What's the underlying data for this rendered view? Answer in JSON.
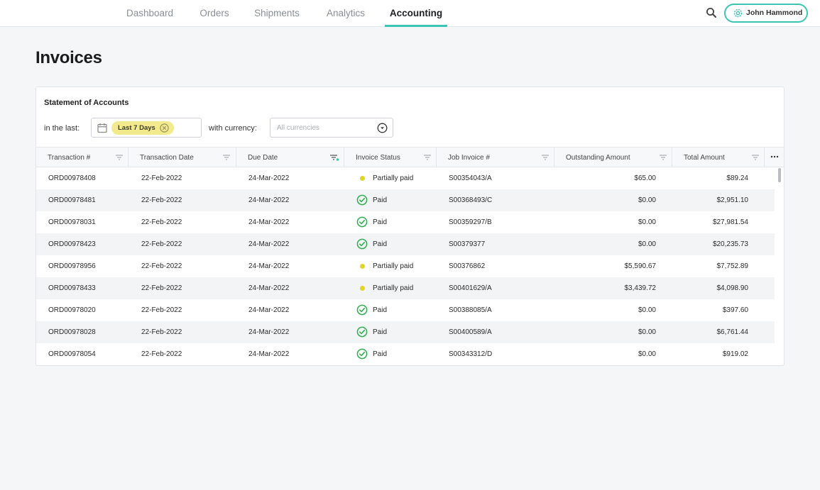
{
  "nav": {
    "tabs": [
      {
        "label": "Dashboard"
      },
      {
        "label": "Orders"
      },
      {
        "label": "Shipments"
      },
      {
        "label": "Analytics"
      },
      {
        "label": "Accounting"
      }
    ],
    "active_tab": "Accounting",
    "search_icon": "search-icon",
    "user": {
      "name": "John Hammond",
      "icon": "gear-icon"
    }
  },
  "page": {
    "title": "Invoices"
  },
  "statement": {
    "title": "Statement of Accounts",
    "period_label": "in the last:",
    "period_chip": "Last 7 Days",
    "currency_label": "with currency:",
    "currency_placeholder": "All currencies"
  },
  "table": {
    "columns": [
      "Transaction #",
      "Transaction Date",
      "Due Date",
      "Invoice Status",
      "Job Invoice #",
      "Outstanding Amount",
      "Total Amount"
    ],
    "rows": [
      {
        "transaction": "ORD00978408",
        "date": "22-Feb-2022",
        "due": "24-Mar-2022",
        "status": "Partially paid",
        "job": "S00354043/A",
        "outstanding": "$65.00",
        "total": "$89.24"
      },
      {
        "transaction": "ORD00978481",
        "date": "22-Feb-2022",
        "due": "24-Mar-2022",
        "status": "Paid",
        "job": "S00368493/C",
        "outstanding": "$0.00",
        "total": "$2,951.10"
      },
      {
        "transaction": "ORD00978031",
        "date": "22-Feb-2022",
        "due": "24-Mar-2022",
        "status": "Paid",
        "job": "S00359297/B",
        "outstanding": "$0.00",
        "total": "$27,981.54"
      },
      {
        "transaction": "ORD00978423",
        "date": "22-Feb-2022",
        "due": "24-Mar-2022",
        "status": "Paid",
        "job": "S00379377",
        "outstanding": "$0.00",
        "total": "$20,235.73"
      },
      {
        "transaction": "ORD00978956",
        "date": "22-Feb-2022",
        "due": "24-Mar-2022",
        "status": "Partially paid",
        "job": "S00376862",
        "outstanding": "$5,590.67",
        "total": "$7,752.89"
      },
      {
        "transaction": "ORD00978433",
        "date": "22-Feb-2022",
        "due": "24-Mar-2022",
        "status": "Partially paid",
        "job": "S00401629/A",
        "outstanding": "$3,439.72",
        "total": "$4,098.90"
      },
      {
        "transaction": "ORD00978020",
        "date": "22-Feb-2022",
        "due": "24-Mar-2022",
        "status": "Paid",
        "job": "S00388085/A",
        "outstanding": "$0.00",
        "total": "$397.60"
      },
      {
        "transaction": "ORD00978028",
        "date": "22-Feb-2022",
        "due": "24-Mar-2022",
        "status": "Paid",
        "job": "S00400589/A",
        "outstanding": "$0.00",
        "total": "$6,761.44"
      },
      {
        "transaction": "ORD00978054",
        "date": "22-Feb-2022",
        "due": "24-Mar-2022",
        "status": "Paid",
        "job": "S00343312/D",
        "outstanding": "$0.00",
        "total": "$919.02"
      }
    ]
  },
  "colors": {
    "accent": "#3cc4b4",
    "paid": "#2fae4e",
    "partial": "#e3d42a",
    "chip": "#f2ea8c"
  }
}
